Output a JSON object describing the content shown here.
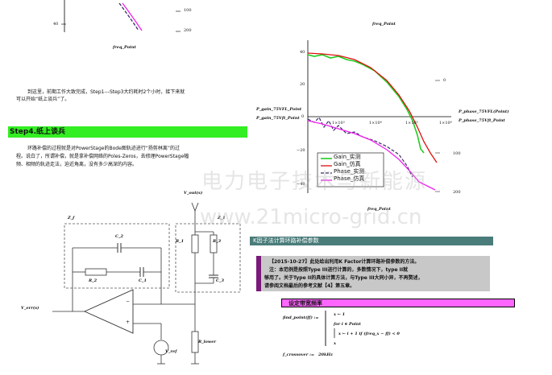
{
  "top_plot": {
    "tick_right_top": "100",
    "tick_right_mid": "200",
    "tick_left": "40",
    "xlabel": "freq_Point"
  },
  "para1": {
    "line1": "到这里，前期工作大致完成，Step1---Step3大约耗时2个小时，接下来就",
    "line2": "可以开始“纸上谈兵”了。"
  },
  "step4_heading": "Step4.纸上谈兵",
  "para2": {
    "line1": "环路补偿的过程就是对PowerStage的Bode图轨迹进行“扬剪林离”的过",
    "line2": "程。说白了，所谓补偿，就是拿补偿网络的Poles-Zeros，去修理PowerStage幅",
    "line3": "频、相频的轨迹走法，迫近角离，没有多少高深的内容。"
  },
  "circuit": {
    "vout_label": "V_out(s)",
    "zf_label": "Z_f",
    "z1_label": "Z_1",
    "c2": "C_2",
    "r2": "R_2",
    "c1": "C_1",
    "r1": "R_1",
    "r3": "R_3",
    "c3": "C_3",
    "verr": "V_err(s)",
    "vref": "V_ref",
    "rlower": "R_lower",
    "minus": "−",
    "plus": "+"
  },
  "bode": {
    "title": "freq_Point",
    "xlabel": "freq_Point",
    "left_ticks": [
      "40",
      "20",
      "0",
      "−20",
      "−40"
    ],
    "right_ticks": [
      "0",
      "100",
      "200"
    ],
    "x_ticks": [
      "1×10³",
      "1×10⁴",
      "1×10⁵",
      "1×10⁶"
    ],
    "left_label1": "P_gain_75VFL_Point",
    "left_label2": "P_gain_75Vft_Point",
    "right_label1": "P_phase_75VFL(Point)",
    "right_label2": "P_phase_75Vft_Point",
    "legend": [
      "Gain_实测",
      "Gain_仿真",
      "Phase_实测",
      "Phase_仿真"
    ],
    "colors": {
      "gain_meas": "#22cc22",
      "gain_sim": "#dd1111",
      "phase_meas": "#3a2a6a",
      "phase_sim": "#ee22ee"
    }
  },
  "kfactor_heading": "K因子法计算环路补偿参数",
  "note": {
    "line1": "【2015-10-27】此处给出利用K Factor计算环路补偿参数的方法。",
    "line2": "注：本范例是按照Type III进行计算的，多数情况下，type II就",
    "line3": "够用了。关于Type II的具体计算方法，与Type III大同小异，不再赘述，",
    "line4": "请参阅文档最后的参考文献【4】第五章。"
  },
  "bandwidth_heading": "设定带宽频率",
  "find_point": {
    "name": "find_point(ff) :=",
    "l1": "x ← 1",
    "l2": "for i ∈ Point",
    "l3": "x ← i + 1  if  (freq_x − ff) < 0",
    "l4": "x"
  },
  "fcrossover": {
    "label": "f_crossover :=",
    "value": "20kHz"
  },
  "watermark": {
    "line1": "电力电子技术与新能源",
    "line2": "www.21micro-grid.cn"
  }
}
